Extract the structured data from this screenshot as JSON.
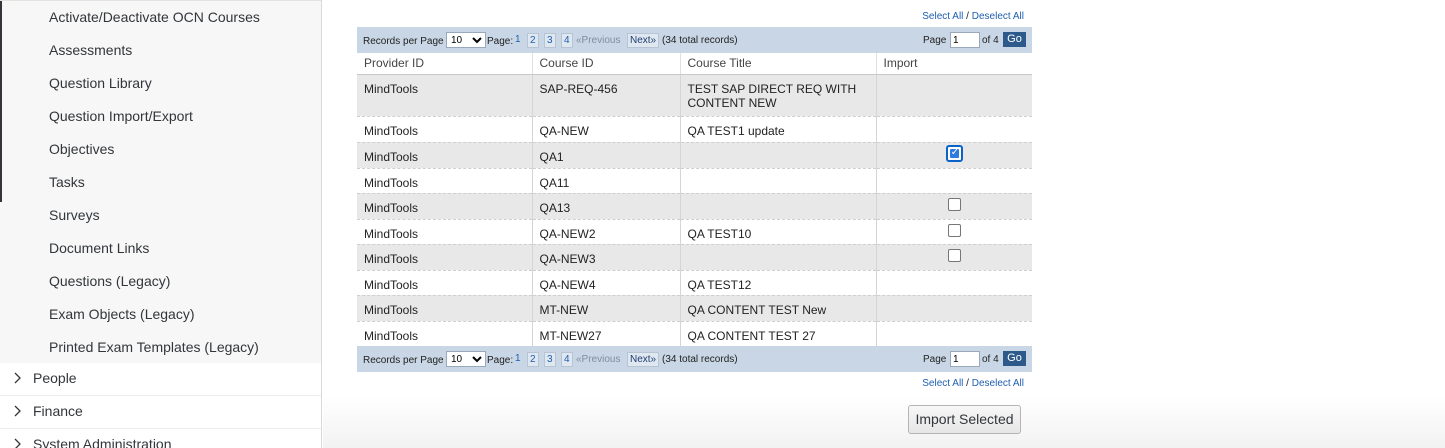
{
  "sidebar": {
    "sub_items": [
      "Activate/Deactivate OCN Courses",
      "Assessments",
      "Question Library",
      "Question Import/Export",
      "Objectives",
      "Tasks",
      "Surveys",
      "Document Links",
      "Questions (Legacy)",
      "Exam Objects (Legacy)",
      "Printed Exam Templates (Legacy)"
    ],
    "categories": [
      "People",
      "Finance",
      "System Administration"
    ]
  },
  "selection": {
    "select_all": "Select All",
    "separator": " / ",
    "deselect_all": "Deselect All"
  },
  "pager": {
    "records_per_page_label": "Records per Page",
    "records_per_page_value": "10",
    "page_label": "Page:",
    "pages": [
      "1",
      "2",
      "3",
      "4"
    ],
    "prev": "«Previous",
    "next": "Next»",
    "total": "(34 total records)",
    "page_input_label": "Page",
    "current_page": "1",
    "of_label": "of 4",
    "go": "Go"
  },
  "table": {
    "headers": [
      "Provider ID",
      "Course ID",
      "Course Title",
      "Import"
    ],
    "rows": [
      {
        "provider": "MindTools",
        "course_id": "SAP-REQ-456",
        "title": "TEST SAP DIRECT REQ WITH CONTENT NEW",
        "checkbox": "none"
      },
      {
        "provider": "MindTools",
        "course_id": "QA-NEW",
        "title": "QA TEST1 update",
        "checkbox": "none"
      },
      {
        "provider": "MindTools",
        "course_id": "QA1",
        "title": "",
        "checkbox": "checked"
      },
      {
        "provider": "MindTools",
        "course_id": "QA11",
        "title": "",
        "checkbox": "none"
      },
      {
        "provider": "MindTools",
        "course_id": "QA13",
        "title": "",
        "checkbox": "unchecked"
      },
      {
        "provider": "MindTools",
        "course_id": "QA-NEW2",
        "title": "QA TEST10",
        "checkbox": "unchecked"
      },
      {
        "provider": "MindTools",
        "course_id": "QA-NEW3",
        "title": "",
        "checkbox": "unchecked"
      },
      {
        "provider": "MindTools",
        "course_id": "QA-NEW4",
        "title": "QA TEST12",
        "checkbox": "none"
      },
      {
        "provider": "MindTools",
        "course_id": "MT-NEW",
        "title": "QA CONTENT TEST New",
        "checkbox": "none"
      },
      {
        "provider": "MindTools",
        "course_id": "MT-NEW27",
        "title": "QA CONTENT TEST 27",
        "checkbox": "none"
      }
    ]
  },
  "import_button": "Import Selected",
  "colors": {
    "accent": "#2d5a8a",
    "pager_bg": "#c8d6e5",
    "link": "#1f5fb0",
    "checkbox": "#0a63c9"
  }
}
